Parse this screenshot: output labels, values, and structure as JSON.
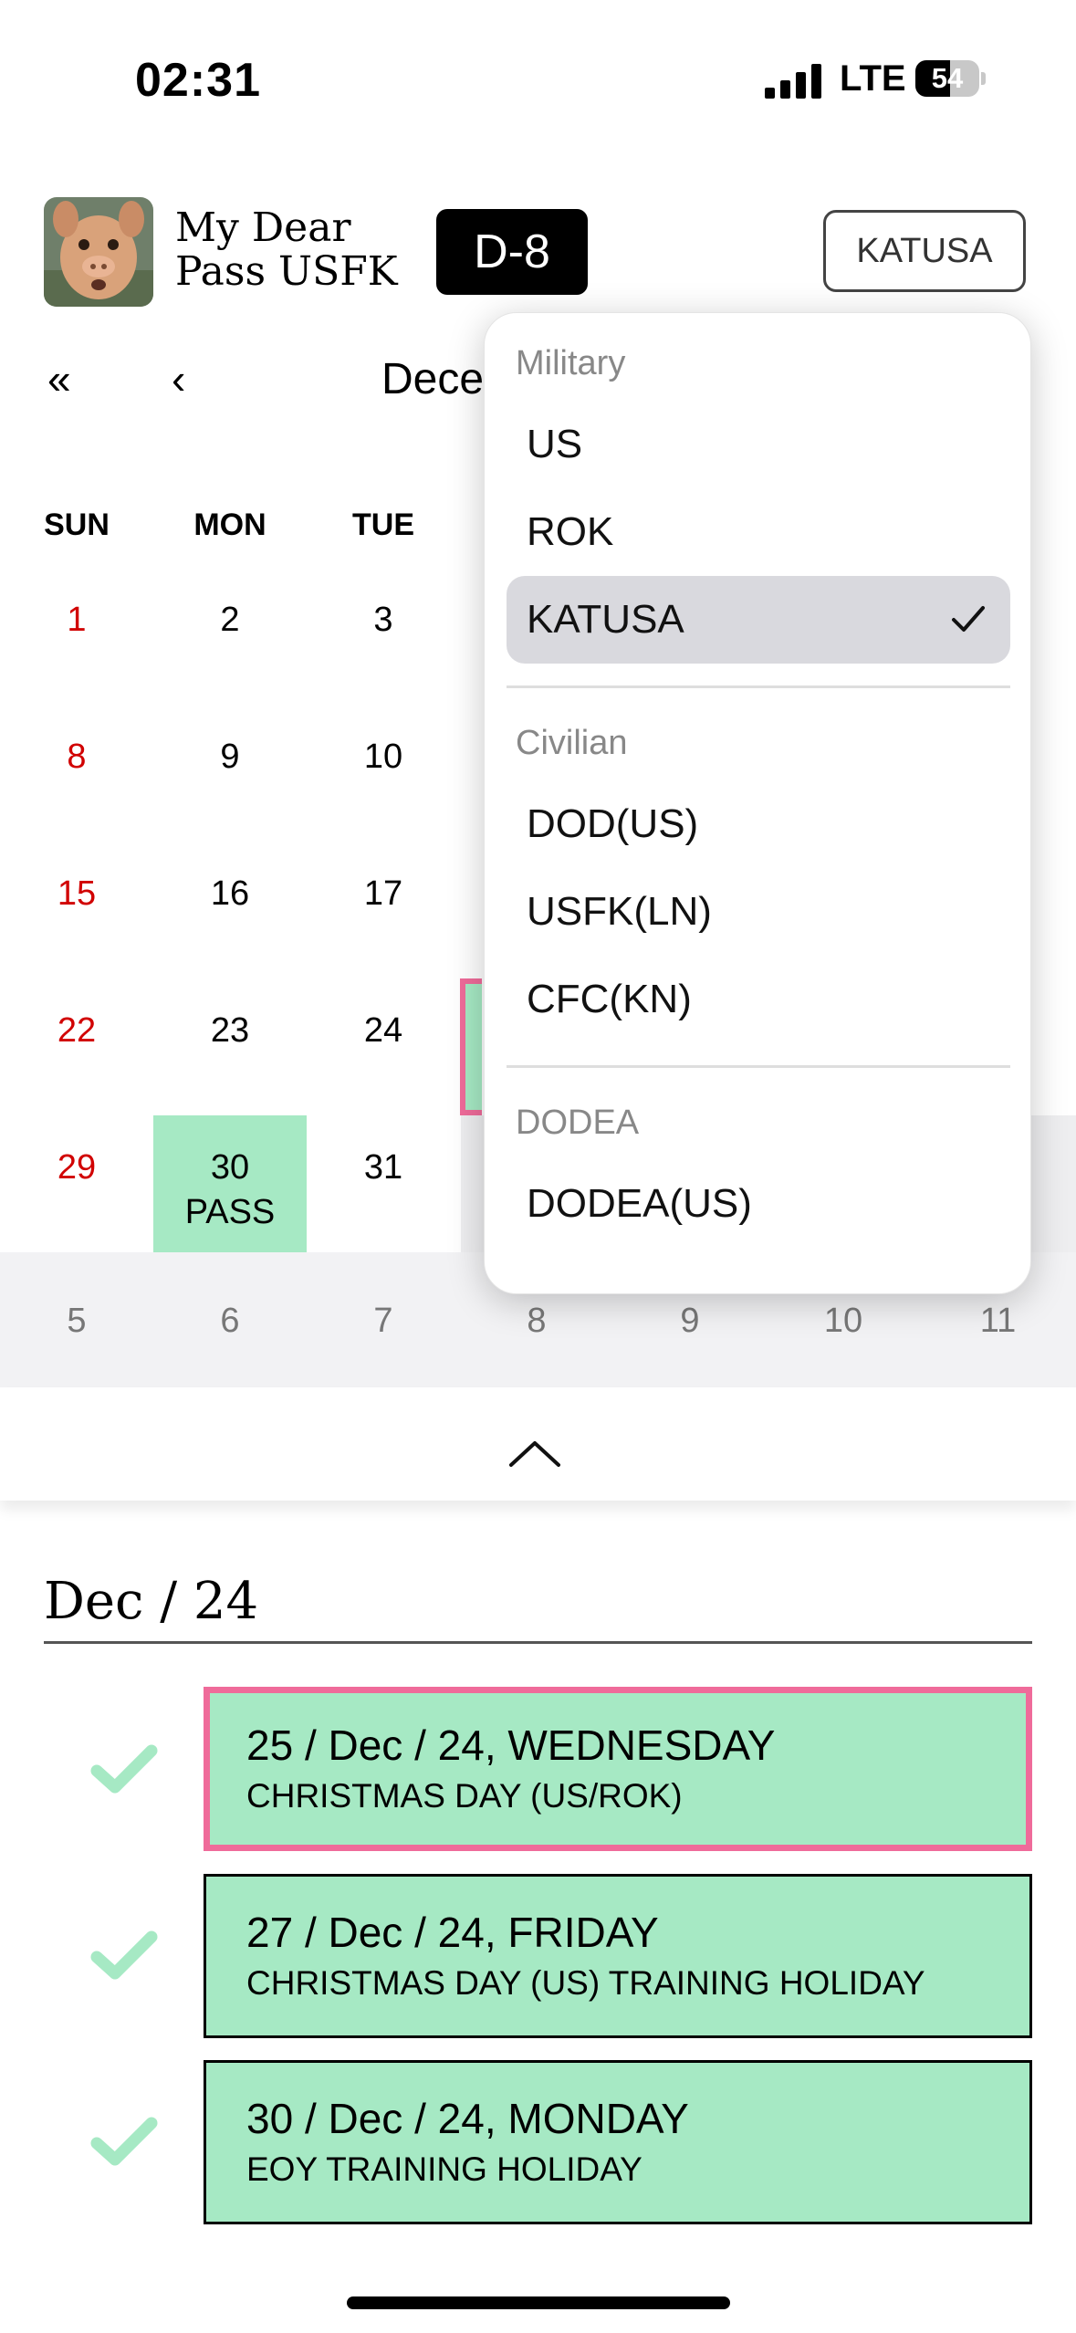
{
  "status_bar": {
    "time": "02:31",
    "network": "LTE",
    "battery": "54",
    "battery_level": 0.54
  },
  "header": {
    "app_title_line1": "My Dear",
    "app_title_line2": "Pass USFK",
    "dday": "D-8",
    "category_button": "KATUSA"
  },
  "calendar": {
    "nav_first": "«",
    "nav_prev": "‹",
    "month_label": "Dece",
    "weekdays": [
      "SUN",
      "MON",
      "TUE"
    ],
    "weeks": [
      [
        "1",
        "2",
        "3"
      ],
      [
        "8",
        "9",
        "10"
      ],
      [
        "15",
        "16",
        "17"
      ],
      [
        "22",
        "23",
        "24"
      ],
      [
        "29",
        "30",
        "31"
      ]
    ],
    "pass_day": "30",
    "pass_label": "PASS",
    "next_week": [
      "5",
      "6",
      "7",
      "8",
      "9",
      "10",
      "11"
    ],
    "colors": {
      "holiday_fill": "#a6e9c4",
      "today_border": "#ef6b9a",
      "sunday_red": "#d10000"
    }
  },
  "dropdown": {
    "groups": [
      {
        "label": "Military",
        "items": [
          "US",
          "ROK",
          "KATUSA"
        ]
      },
      {
        "label": "Civilian",
        "items": [
          "DOD(US)",
          "USFK(LN)",
          "CFC(KN)"
        ]
      },
      {
        "label": "DODEA",
        "items": [
          "DODEA(US)"
        ]
      }
    ],
    "selected": "KATUSA"
  },
  "list": {
    "title": "Dec / 24",
    "events": [
      {
        "date": "25 / Dec / 24, WEDNESDAY",
        "title": "CHRISTMAS DAY (US/ROK)"
      },
      {
        "date": "27 / Dec / 24, FRIDAY",
        "title": "CHRISTMAS DAY (US) TRAINING HOLIDAY"
      },
      {
        "date": "30 / Dec / 24, MONDAY",
        "title": "EOY TRAINING HOLIDAY"
      }
    ]
  }
}
